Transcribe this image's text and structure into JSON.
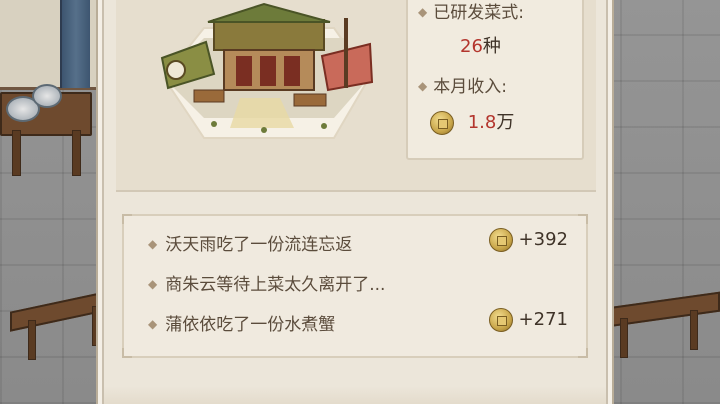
{
  "stats": {
    "dishes_label": "已研发菜式:",
    "dishes_count": "26",
    "dishes_unit": "种",
    "income_label": "本月收入:",
    "income_value": "1.8",
    "income_unit": "万"
  },
  "log": [
    {
      "text": "沃天雨吃了一份流连忘返",
      "reward": "+392",
      "has_coin": true
    },
    {
      "text": "商朱云等待上菜太久离开了...",
      "reward": "",
      "has_coin": false
    },
    {
      "text": "蒲依依吃了一份水煮蟹",
      "reward": "+271",
      "has_coin": true
    }
  ],
  "icons": {
    "coin": "copper-coin-icon",
    "bullet": "diamond-bullet-icon"
  },
  "colors": {
    "highlight_number": "#b3352d",
    "panel_bg": "#ece6da"
  }
}
